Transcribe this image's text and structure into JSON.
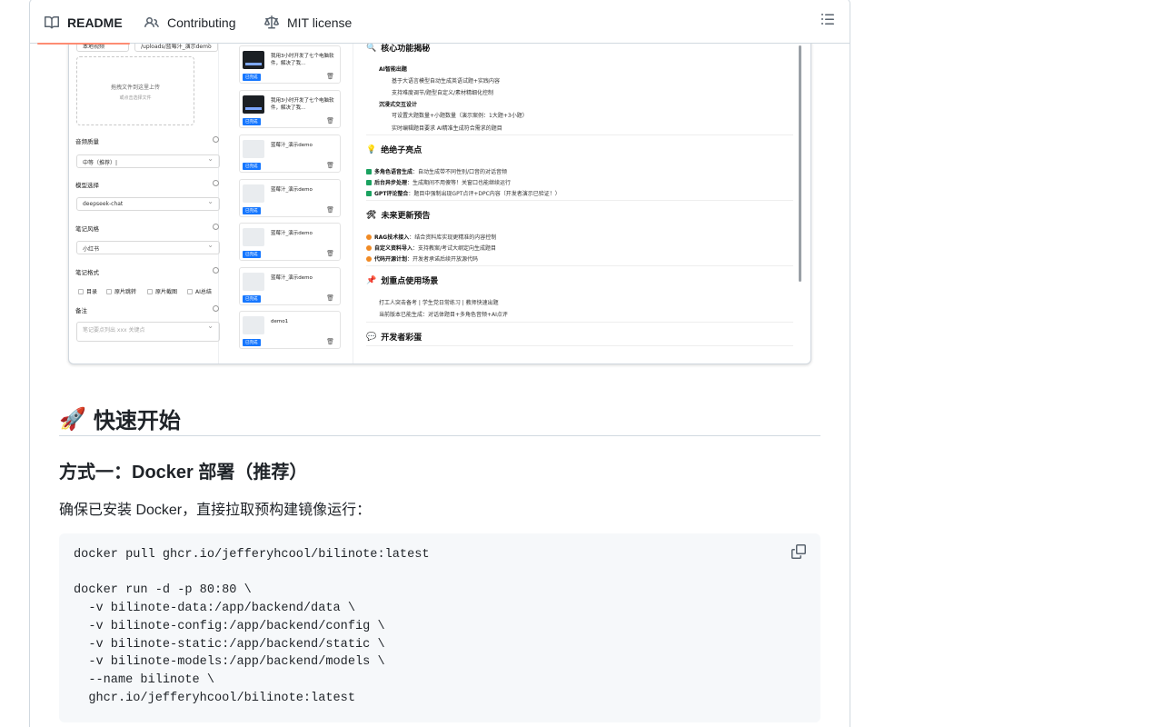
{
  "tabs": [
    {
      "label": "README",
      "icon": "book-icon",
      "active": true
    },
    {
      "label": "Contributing",
      "icon": "people-icon",
      "active": false
    },
    {
      "label": "MIT license",
      "icon": "law-icon",
      "active": false
    }
  ],
  "outline_icon": "outline-list-icon",
  "embedded": {
    "settings": {
      "top_select_left": "本地视频",
      "top_select_right": "/uploads/蓝莓汁_演示demo",
      "upload_title": "拖拽文件到这里上传",
      "upload_sub": "或点击选择文件",
      "quality_label": "音频质量",
      "quality_value": "中等（推荐）|",
      "model_label": "模型选择",
      "model_value": "deepseek-chat",
      "style_label": "笔记风格",
      "style_value": "小红书",
      "format_label": "笔记格式",
      "format_options": [
        "目录",
        "原片跳转",
        "原片截图",
        "AI总结"
      ],
      "remark_label": "备注",
      "remark_placeholder": "笔记要点列出 xxx 关键点"
    },
    "cards": [
      {
        "title": "我用3小时开发了七个电脑软件，解决了我...",
        "badge": "已完成",
        "dark": true
      },
      {
        "title": "我用3小时开发了七个电脑软件，解决了我...",
        "badge": "已完成",
        "dark": true
      },
      {
        "title": "蓝莓汁_演示demo",
        "badge": "已完成",
        "dark": false
      },
      {
        "title": "蓝莓汁_演示demo",
        "badge": "已完成",
        "dark": false
      },
      {
        "title": "蓝莓汁_演示demo",
        "badge": "已完成",
        "dark": false
      },
      {
        "title": "蓝莓汁_演示demo",
        "badge": "已完成",
        "dark": false
      },
      {
        "title": "demo1",
        "badge": "已完成",
        "dark": false
      }
    ],
    "content": {
      "sec1_title": "核心功能揭秘",
      "sec1_sub1": "AI智能出题",
      "sec1_l1": "基于大语言模型自动生成英语试题+实践内容",
      "sec1_l2": "支持难度调节/题型自定义/素材精细化控制",
      "sec1_sub2": "沉浸式交互设计",
      "sec1_l3": "可设置大题数量+小题数量（演示案例：1大题+3小题）",
      "sec1_l4": "实时编辑题目要求 AI精准生成符合需求的题目",
      "sec2_title": "绝绝子亮点",
      "sec2_l1_bold": "多角色语音生成",
      "sec2_l1": "：自动生成带不同性别/口音的对话音频",
      "sec2_l2_bold": "后台异步处理",
      "sec2_l2": "：生成期间不用傻等！关窗口也能继续运行",
      "sec2_l3_bold": "GPT评论整合",
      "sec2_l3": "：题目中强制出现GPT点评+DPC内容（开发者演示已验证！）",
      "sec3_title": "未来更新预告",
      "sec3_l1_bold": "RAG技术接入",
      "sec3_l1": "：结合资料库实现更精准的内容控制",
      "sec3_l2_bold": "自定义资料导入",
      "sec3_l2": "：支持教案/考试大纲定向生成题目",
      "sec3_l3_bold": "代码开源计划",
      "sec3_l3": "：开发者承诺后续开放源代码",
      "sec4_title": "划重点使用场景",
      "sec4_l1": "打工人突击备考 | 学生党日常练习 | 教师快速出题",
      "sec4_l2": "当前版本已能生成：对话体题目+多角色音频+AI点评",
      "sec5_title": "开发者彩蛋"
    }
  },
  "markdown": {
    "h2_emoji": "🚀",
    "h2_text": "快速开始",
    "h3_text": "方式一：Docker 部署（推荐）",
    "paragraph": "确保已安装 Docker，直接拉取预构建镜像运行：",
    "code": "docker pull ghcr.io/jefferyhcool/bilinote:latest\n\ndocker run -d -p 80:80 \\\n  -v bilinote-data:/app/backend/data \\\n  -v bilinote-config:/app/backend/config \\\n  -v bilinote-static:/app/backend/static \\\n  -v bilinote-models:/app/backend/models \\\n  --name bilinote \\\n  ghcr.io/jefferyhcool/bilinote:latest",
    "copy_icon": "copy-icon"
  },
  "colors": {
    "active_tab_underline": "#fd8c73",
    "border": "#d1d9e0",
    "code_bg": "#f6f8fa",
    "badge_blue": "#1677ff"
  }
}
